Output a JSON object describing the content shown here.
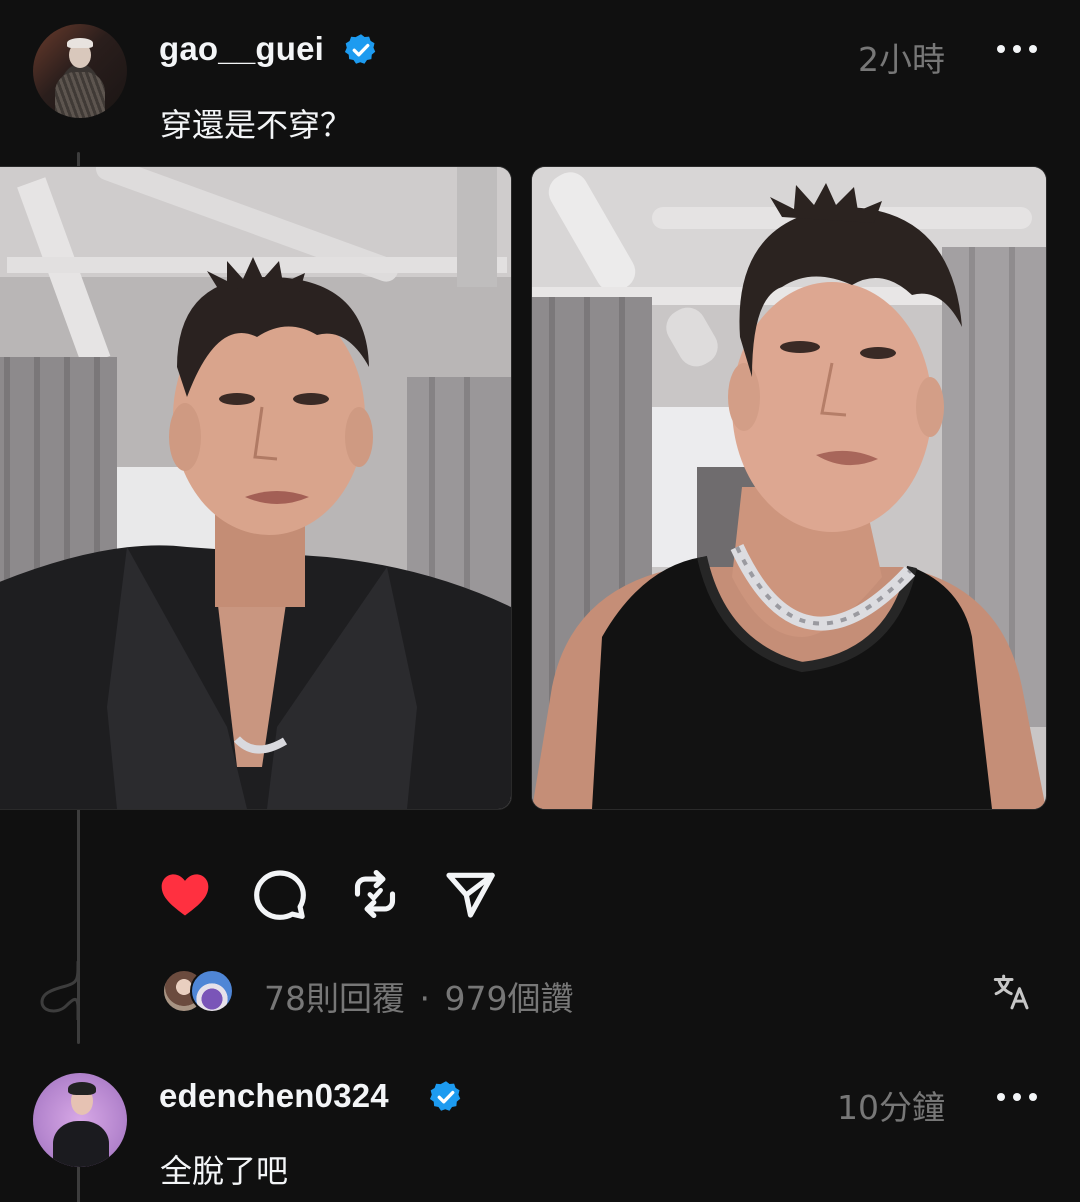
{
  "post": {
    "username": "gao__guei",
    "timestamp": "2小時",
    "caption": "穿還是不穿？",
    "replies_text": "78則回覆",
    "separator": "·",
    "likes_text": "979個讚",
    "liked": true,
    "like_color": "#ff3040"
  },
  "reply": {
    "username": "edenchen0324",
    "timestamp": "10分鐘",
    "caption": "全脫了吧"
  },
  "icons": {
    "verified": "verified-badge-icon",
    "more": "more-horizontal-icon",
    "like": "heart-filled-icon",
    "comment": "comment-bubble-icon",
    "repost": "repost-icon",
    "share": "send-icon",
    "translate": "translate-icon"
  },
  "colors": {
    "background": "#101010",
    "verified": "#1d9bf0",
    "secondary_text": "#777777"
  }
}
